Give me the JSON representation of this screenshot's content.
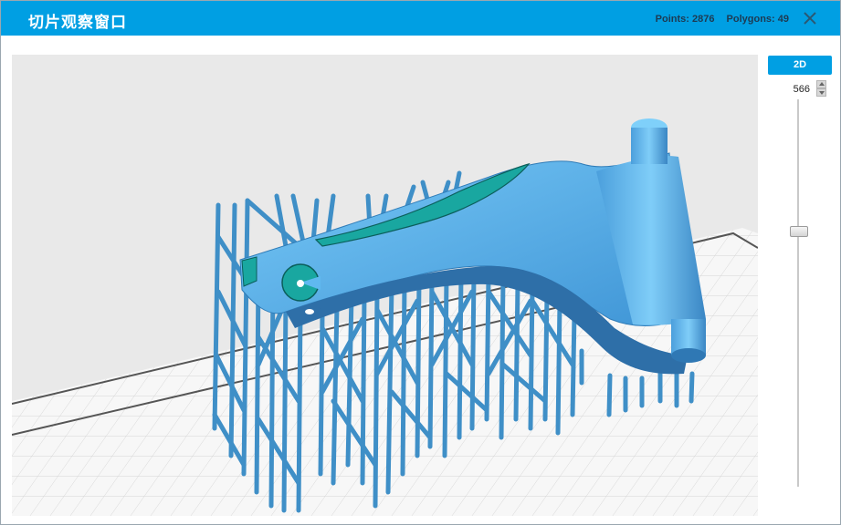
{
  "window": {
    "title": "切片观察窗口",
    "points_label": "Points: 2876",
    "polygons_label": "Polygons: 49",
    "close_icon": "close-icon"
  },
  "side_panel": {
    "mode_button": "2D",
    "layer_value": "566",
    "slider_icon": "vertical-slider",
    "layer_fraction": 0.56
  },
  "viewport": {
    "scene": "3D slice preview of part with support structures on build plate",
    "colors": {
      "part": "#5fb9f0",
      "part_dark": "#3a8fd0",
      "support": "#3f8fc7",
      "cross_section": "#19a7a0",
      "grid": "#d3d3d3",
      "plate": "#f7f7f7",
      "background": "#e9e9e9"
    }
  }
}
